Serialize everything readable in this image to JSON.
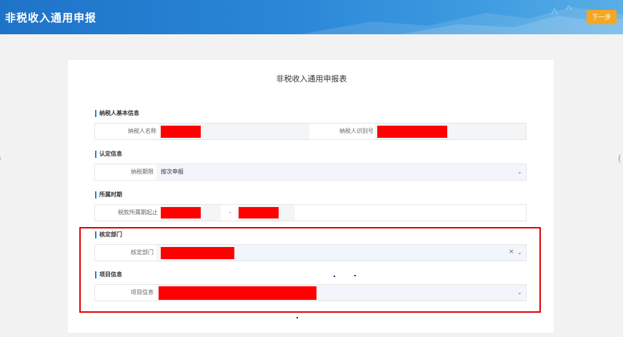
{
  "header": {
    "title": "非税收入通用申报",
    "next_button": "下一步"
  },
  "form": {
    "title": "非税收入通用申报表",
    "sections": {
      "taxpayer_info": {
        "label": "纳税人基本信息",
        "name_label": "纳税人名称",
        "id_label": "纳税人识别号"
      },
      "assessment_info": {
        "label": "认定信息",
        "period_label": "纳税期限",
        "period_value": "按次申报"
      },
      "period": {
        "label": "所属时期",
        "range_label": "税款所属期起止",
        "separator": "-"
      },
      "department": {
        "label": "核定部门",
        "field_label": "核定部门"
      },
      "project": {
        "label": "项目信息",
        "field_label": "项目信息"
      }
    }
  },
  "colors": {
    "accent_blue": "#2a7fd4",
    "header_blue": "#1e73c8",
    "button_orange": "#f5a623",
    "highlight_red": "#e00000",
    "redaction": "#ff0000"
  }
}
